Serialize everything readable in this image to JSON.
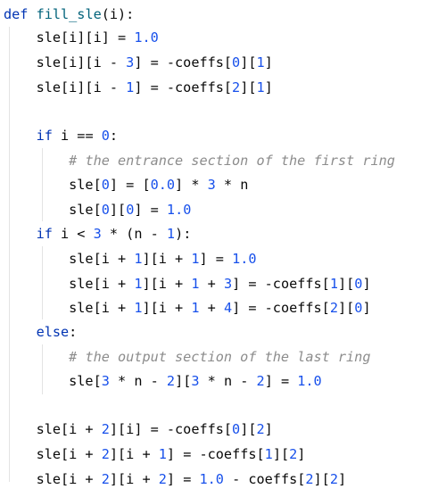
{
  "code": {
    "lines": [
      {
        "tokens": [
          {
            "t": "def",
            "c": "kw"
          },
          {
            "t": " ",
            "c": "op"
          },
          {
            "t": "fill_sle",
            "c": "fn"
          },
          {
            "t": "(i):",
            "c": "op"
          }
        ]
      },
      {
        "tokens": [
          {
            "t": "    sle[i][i] = ",
            "c": "op"
          },
          {
            "t": "1.0",
            "c": "num"
          }
        ]
      },
      {
        "tokens": [
          {
            "t": "    sle[i][i - ",
            "c": "op"
          },
          {
            "t": "3",
            "c": "num"
          },
          {
            "t": "] = -coeffs[",
            "c": "op"
          },
          {
            "t": "0",
            "c": "num"
          },
          {
            "t": "][",
            "c": "op"
          },
          {
            "t": "1",
            "c": "num"
          },
          {
            "t": "]",
            "c": "op"
          }
        ]
      },
      {
        "tokens": [
          {
            "t": "    sle[i][i - ",
            "c": "op"
          },
          {
            "t": "1",
            "c": "num"
          },
          {
            "t": "] = -coeffs[",
            "c": "op"
          },
          {
            "t": "2",
            "c": "num"
          },
          {
            "t": "][",
            "c": "op"
          },
          {
            "t": "1",
            "c": "num"
          },
          {
            "t": "]",
            "c": "op"
          }
        ]
      },
      {
        "tokens": []
      },
      {
        "tokens": [
          {
            "t": "    ",
            "c": "op"
          },
          {
            "t": "if",
            "c": "kw"
          },
          {
            "t": " i == ",
            "c": "op"
          },
          {
            "t": "0",
            "c": "num"
          },
          {
            "t": ":",
            "c": "op"
          }
        ]
      },
      {
        "tokens": [
          {
            "t": "        ",
            "c": "op"
          },
          {
            "t": "# the entrance section of the first ring",
            "c": "cm"
          }
        ]
      },
      {
        "tokens": [
          {
            "t": "        sle[",
            "c": "op"
          },
          {
            "t": "0",
            "c": "num"
          },
          {
            "t": "] = [",
            "c": "op"
          },
          {
            "t": "0.0",
            "c": "num"
          },
          {
            "t": "] * ",
            "c": "op"
          },
          {
            "t": "3",
            "c": "num"
          },
          {
            "t": " * n",
            "c": "op"
          }
        ]
      },
      {
        "tokens": [
          {
            "t": "        sle[",
            "c": "op"
          },
          {
            "t": "0",
            "c": "num"
          },
          {
            "t": "][",
            "c": "op"
          },
          {
            "t": "0",
            "c": "num"
          },
          {
            "t": "] = ",
            "c": "op"
          },
          {
            "t": "1.0",
            "c": "num"
          }
        ]
      },
      {
        "tokens": [
          {
            "t": "    ",
            "c": "op"
          },
          {
            "t": "if",
            "c": "kw"
          },
          {
            "t": " i < ",
            "c": "op"
          },
          {
            "t": "3",
            "c": "num"
          },
          {
            "t": " * (n - ",
            "c": "op"
          },
          {
            "t": "1",
            "c": "num"
          },
          {
            "t": "):",
            "c": "op"
          }
        ]
      },
      {
        "tokens": [
          {
            "t": "        sle[i + ",
            "c": "op"
          },
          {
            "t": "1",
            "c": "num"
          },
          {
            "t": "][i + ",
            "c": "op"
          },
          {
            "t": "1",
            "c": "num"
          },
          {
            "t": "] = ",
            "c": "op"
          },
          {
            "t": "1.0",
            "c": "num"
          }
        ]
      },
      {
        "tokens": [
          {
            "t": "        sle[i + ",
            "c": "op"
          },
          {
            "t": "1",
            "c": "num"
          },
          {
            "t": "][i + ",
            "c": "op"
          },
          {
            "t": "1",
            "c": "num"
          },
          {
            "t": " + ",
            "c": "op"
          },
          {
            "t": "3",
            "c": "num"
          },
          {
            "t": "] = -coeffs[",
            "c": "op"
          },
          {
            "t": "1",
            "c": "num"
          },
          {
            "t": "][",
            "c": "op"
          },
          {
            "t": "0",
            "c": "num"
          },
          {
            "t": "]",
            "c": "op"
          }
        ]
      },
      {
        "tokens": [
          {
            "t": "        sle[i + ",
            "c": "op"
          },
          {
            "t": "1",
            "c": "num"
          },
          {
            "t": "][i + ",
            "c": "op"
          },
          {
            "t": "1",
            "c": "num"
          },
          {
            "t": " + ",
            "c": "op"
          },
          {
            "t": "4",
            "c": "num"
          },
          {
            "t": "] = -coeffs[",
            "c": "op"
          },
          {
            "t": "2",
            "c": "num"
          },
          {
            "t": "][",
            "c": "op"
          },
          {
            "t": "0",
            "c": "num"
          },
          {
            "t": "]",
            "c": "op"
          }
        ]
      },
      {
        "tokens": [
          {
            "t": "    ",
            "c": "op"
          },
          {
            "t": "else",
            "c": "kw"
          },
          {
            "t": ":",
            "c": "op"
          }
        ]
      },
      {
        "tokens": [
          {
            "t": "        ",
            "c": "op"
          },
          {
            "t": "# the output section of the last ring",
            "c": "cm"
          }
        ]
      },
      {
        "tokens": [
          {
            "t": "        sle[",
            "c": "op"
          },
          {
            "t": "3",
            "c": "num"
          },
          {
            "t": " * n - ",
            "c": "op"
          },
          {
            "t": "2",
            "c": "num"
          },
          {
            "t": "][",
            "c": "op"
          },
          {
            "t": "3",
            "c": "num"
          },
          {
            "t": " * n - ",
            "c": "op"
          },
          {
            "t": "2",
            "c": "num"
          },
          {
            "t": "] = ",
            "c": "op"
          },
          {
            "t": "1.0",
            "c": "num"
          }
        ]
      },
      {
        "tokens": []
      },
      {
        "tokens": [
          {
            "t": "    sle[i + ",
            "c": "op"
          },
          {
            "t": "2",
            "c": "num"
          },
          {
            "t": "][i] = -coeffs[",
            "c": "op"
          },
          {
            "t": "0",
            "c": "num"
          },
          {
            "t": "][",
            "c": "op"
          },
          {
            "t": "2",
            "c": "num"
          },
          {
            "t": "]",
            "c": "op"
          }
        ]
      },
      {
        "tokens": [
          {
            "t": "    sle[i + ",
            "c": "op"
          },
          {
            "t": "2",
            "c": "num"
          },
          {
            "t": "][i + ",
            "c": "op"
          },
          {
            "t": "1",
            "c": "num"
          },
          {
            "t": "] = -coeffs[",
            "c": "op"
          },
          {
            "t": "1",
            "c": "num"
          },
          {
            "t": "][",
            "c": "op"
          },
          {
            "t": "2",
            "c": "num"
          },
          {
            "t": "]",
            "c": "op"
          }
        ]
      },
      {
        "tokens": [
          {
            "t": "    sle[i + ",
            "c": "op"
          },
          {
            "t": "2",
            "c": "num"
          },
          {
            "t": "][i + ",
            "c": "op"
          },
          {
            "t": "2",
            "c": "num"
          },
          {
            "t": "] = ",
            "c": "op"
          },
          {
            "t": "1.0",
            "c": "num"
          },
          {
            "t": " - coeffs[",
            "c": "op"
          },
          {
            "t": "2",
            "c": "num"
          },
          {
            "t": "][",
            "c": "op"
          },
          {
            "t": "2",
            "c": "num"
          },
          {
            "t": "]",
            "c": "op"
          }
        ]
      }
    ]
  },
  "colors": {
    "keyword": "#0033b3",
    "function_name": "#00627a",
    "number": "#1750eb",
    "text": "#080808",
    "comment": "#8c8c8c",
    "indent_guide": "#e3e3e3",
    "background": "#ffffff"
  }
}
